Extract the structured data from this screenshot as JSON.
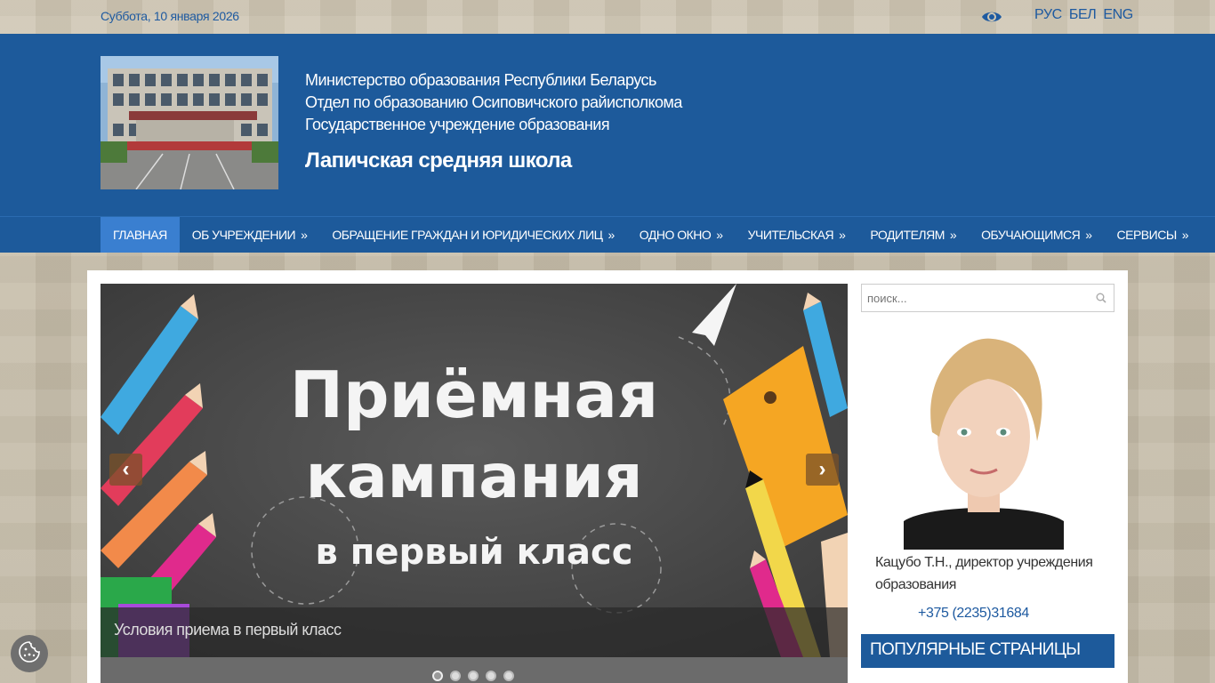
{
  "topbar": {
    "date": "Суббота, 10 января 2026",
    "languages": [
      "РУС",
      "БЕЛ",
      "ENG"
    ],
    "accessibility_icon": "eye-icon"
  },
  "header": {
    "lines": [
      "Министерство образования Республики Беларусь",
      "Отдел по образованию Осиповичского райисполкома",
      "Государственное учреждение образования"
    ],
    "school_name": "Лапичская средняя школа"
  },
  "nav": {
    "items": [
      {
        "label": "Главная",
        "has_submenu": false,
        "active": true
      },
      {
        "label": "Об учреждении",
        "has_submenu": true
      },
      {
        "label": "Обращение граждан и юридических лиц",
        "has_submenu": true
      },
      {
        "label": "Одно окно",
        "has_submenu": true
      },
      {
        "label": "Учительская",
        "has_submenu": true
      },
      {
        "label": "Родителям",
        "has_submenu": true
      },
      {
        "label": "Обучающимся",
        "has_submenu": true
      },
      {
        "label": "Сервисы",
        "has_submenu": true
      }
    ],
    "submenu_marker": "»"
  },
  "slider": {
    "image_text_line1": "Приёмная",
    "image_text_line2": "кампания",
    "image_text_line3": "в первый класс",
    "caption": "Условия приема в первый класс",
    "prev_icon": "chevron-left-icon",
    "next_icon": "chevron-right-icon",
    "dots_count": 5,
    "active_dot": 0
  },
  "sidebar": {
    "search_placeholder": "поиск...",
    "director_name": "Кацубо Т.Н., директор учреждения образования",
    "director_phone": "+375 (2235)31684",
    "popular_title": "Популярные страницы"
  },
  "colors": {
    "brand_blue": "#1d5a9b",
    "active_nav": "#3a7fd0",
    "link_blue": "#1e5aa0"
  }
}
